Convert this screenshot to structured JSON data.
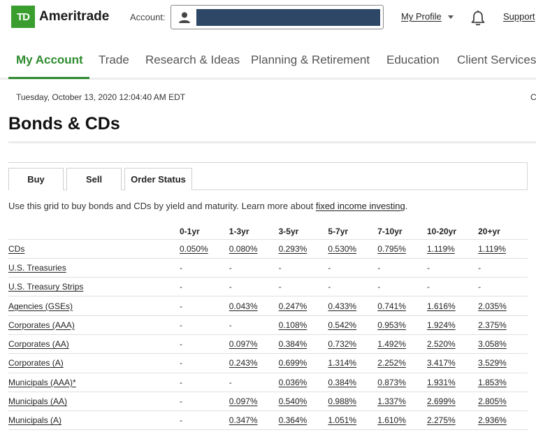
{
  "header": {
    "logo_mark": "TD",
    "logo_name": "Ameritrade",
    "account_label": "Account:",
    "profile_label": "My Profile",
    "support_label": "Support"
  },
  "nav": {
    "items": [
      "My Account",
      "Trade",
      "Research & Ideas",
      "Planning & Retirement",
      "Education",
      "Client Services"
    ],
    "active": "My Account",
    "accent_color": "#2e8b2f"
  },
  "timestamp": "Tuesday, October 13, 2020 12:04:40 AM EDT",
  "right_edge_text": "C",
  "page_title": "Bonds & CDs",
  "tabs": [
    "Buy",
    "Sell",
    "Order Status"
  ],
  "active_tab": "Buy",
  "description": {
    "text": "Use this grid to buy bonds and CDs by yield and maturity. Learn more about ",
    "link": "fixed income investing",
    "suffix": "."
  },
  "grid": {
    "columns": [
      "0-1yr",
      "1-3yr",
      "3-5yr",
      "5-7yr",
      "7-10yr",
      "10-20yr",
      "20+yr"
    ],
    "rows": [
      {
        "label": "CDs",
        "values": [
          "0.050%",
          "0.080%",
          "0.293%",
          "0.530%",
          "0.795%",
          "1.119%",
          "1.119%"
        ]
      },
      {
        "label": "U.S. Treasuries",
        "values": [
          "-",
          "-",
          "-",
          "-",
          "-",
          "-",
          "-"
        ]
      },
      {
        "label": "U.S. Treasury Strips",
        "values": [
          "-",
          "-",
          "-",
          "-",
          "-",
          "-",
          "-"
        ]
      },
      {
        "label": "Agencies (GSEs)",
        "values": [
          "-",
          "0.043%",
          "0.247%",
          "0.433%",
          "0.741%",
          "1.616%",
          "2.035%"
        ]
      },
      {
        "label": "Corporates (AAA)",
        "values": [
          "-",
          "-",
          "0.108%",
          "0.542%",
          "0.953%",
          "1.924%",
          "2.375%"
        ]
      },
      {
        "label": "Corporates (AA)",
        "values": [
          "-",
          "0.097%",
          "0.384%",
          "0.732%",
          "1.492%",
          "2.520%",
          "3.058%"
        ]
      },
      {
        "label": "Corporates (A)",
        "values": [
          "-",
          "0.243%",
          "0.699%",
          "1.314%",
          "2.252%",
          "3.417%",
          "3.529%"
        ]
      },
      {
        "label": "Municipals (AAA)*",
        "values": [
          "-",
          "-",
          "0.036%",
          "0.384%",
          "0.873%",
          "1.931%",
          "1.853%"
        ]
      },
      {
        "label": "Municipals (AA)",
        "values": [
          "-",
          "0.097%",
          "0.540%",
          "0.988%",
          "1.337%",
          "2.699%",
          "2.805%"
        ]
      },
      {
        "label": "Municipals (A)",
        "values": [
          "-",
          "0.347%",
          "0.364%",
          "1.051%",
          "1.610%",
          "2.275%",
          "2.936%"
        ]
      }
    ]
  },
  "icons": {
    "user": "user-icon",
    "bell": "bell-icon",
    "caret": "chevron-down-icon"
  }
}
